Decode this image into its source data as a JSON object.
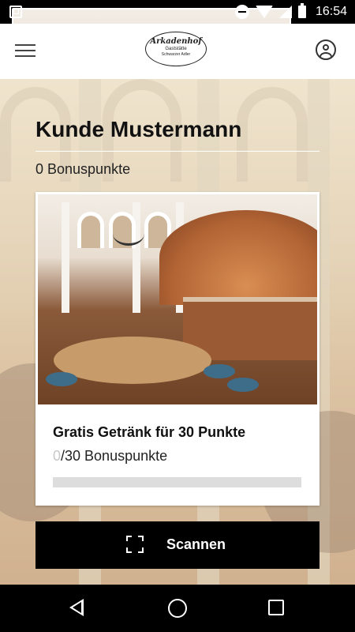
{
  "status_bar": {
    "time": "16:54",
    "icons": [
      "photo-icon",
      "cast-icon",
      "do-not-disturb-icon",
      "wifi-icon",
      "signal-icon",
      "battery-icon"
    ],
    "signal_badge": "R"
  },
  "header": {
    "menu_icon": "hamburger-menu-icon",
    "logo": {
      "name": "Arkadenhof",
      "line2": "Gaststätte",
      "line3": "Schwarzer Adler"
    },
    "profile_icon": "user-profile-icon"
  },
  "customer": {
    "name": "Kunde Mustermann",
    "points_label": "0 Bonuspunkte"
  },
  "reward": {
    "title": "Gratis Getränk für 30 Punkte",
    "current": "0",
    "total_text": "/30 Bonuspunkte",
    "progress_fraction": 0
  },
  "scan_button": {
    "label": "Scannen",
    "icon": "scan-frame-icon"
  },
  "nav": {
    "back_icon": "back-triangle-icon",
    "home_icon": "home-circle-icon",
    "recent_icon": "recent-apps-square-icon"
  },
  "colors": {
    "button_bg": "#000000",
    "progress_track": "#dddddd",
    "progress_current_text": "#c8c8c8"
  }
}
